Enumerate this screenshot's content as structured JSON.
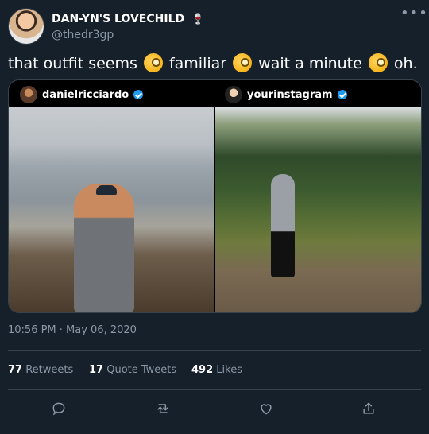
{
  "tweet": {
    "display_name": "DAN-YN'S LOVECHILD",
    "display_name_emoji": "🍷",
    "handle": "@thedr3gp",
    "text_parts": [
      "that outfit seems ",
      " familiar ",
      " wait a minute ",
      " oh."
    ],
    "media": {
      "left_user": "danielricciardo",
      "right_user": "yourinstagram"
    },
    "timestamp": "10:56 PM · May 06, 2020",
    "stats": {
      "retweets_count": "77",
      "retweets_label": " Retweets",
      "quotes_count": "17",
      "quotes_label": " Quote Tweets",
      "likes_count": "492",
      "likes_label": " Likes"
    }
  },
  "icons": {
    "more": "more-icon",
    "reply": "reply-icon",
    "retweet": "retweet-icon",
    "like": "like-icon",
    "share": "share-icon",
    "emoji": "monocle-face-emoji"
  },
  "colors": {
    "background": "#15202b",
    "muted_text": "#8b98a5",
    "border": "#38444d",
    "verified": "#1d9bf0"
  }
}
